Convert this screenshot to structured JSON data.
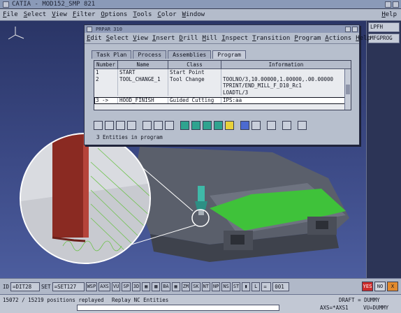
{
  "app": {
    "title": "CATIA - MOD152_SMP 821",
    "menu": [
      "File",
      "Select",
      "View",
      "Filter",
      "Options",
      "Tools",
      "Color",
      "Window"
    ],
    "help": "Help"
  },
  "side_panel": {
    "items": [
      "LPFH",
      "MFGPROG"
    ]
  },
  "dialog": {
    "title": "PRPAR 310",
    "menu": [
      "Edit",
      "Select",
      "View",
      "Insert",
      "Drill",
      "Mill",
      "Inspect",
      "Transition",
      "Program",
      "Actions"
    ],
    "help": "Help",
    "tabs": [
      "Task Plan",
      "Process",
      "Assemblies",
      "Program"
    ],
    "active_tab": "Program",
    "table": {
      "headers": [
        "Number",
        "Name",
        "Class",
        "Information"
      ],
      "rows": [
        {
          "num": "1",
          "name": "START",
          "cls": "Start Point",
          "info": ""
        },
        {
          "num": "2",
          "name": "TOOL_CHANGE_1",
          "cls": "Tool Change",
          "info": "TOOLNO/3,10.00000,1.00000,.00.00000"
        },
        {
          "num": "",
          "name": "",
          "cls": "",
          "info": "TPRINT/END_MILL_F_D10_Rc1"
        },
        {
          "num": "",
          "name": "",
          "cls": "",
          "info": "LOADTL/3"
        },
        {
          "num": "3 ->",
          "name": "HOOD_FINISH",
          "cls": "Guided Cutting",
          "info": "IPS:aa"
        }
      ]
    },
    "toolbar_icons": [
      "copy-icon",
      "paste-icon",
      "edit-icon",
      "flip-icon",
      "insert-left-icon",
      "insert-tool-icon",
      "machine-icon",
      "teal-op-1-icon",
      "teal-op-2-icon",
      "teal-op-3-icon",
      "teal-op-4-icon",
      "fp-icon",
      "blue-box-icon",
      "pencil-icon",
      "arrow-icon",
      "tag-icon",
      "wrench-icon"
    ],
    "status": "3 Entities in program"
  },
  "bottombar": {
    "id_label": "ID",
    "id_value": "=DIT28",
    "set_label": "SET",
    "set_value": "=SET127",
    "buttons": [
      "WSP",
      "AXS",
      "VU",
      "SP",
      "3D"
    ],
    "buttons2": [
      "BA",
      "ZM",
      "SK",
      "NT",
      "NP",
      "NS",
      "ST"
    ],
    "line_label": "L",
    "line_value": "=",
    "count_value": "001",
    "flags": [
      "YES",
      "NO",
      "X"
    ]
  },
  "statusbar": {
    "positions": "15072 / 15219 positions replayed",
    "replay": "Replay NC Entities",
    "draft": "DRAFT = DUMMY",
    "axs": "AXS=*AXS1",
    "vu": "VU=DUMMY",
    "progress": 0.99
  },
  "colors": {
    "accent_green": "#3fc23a",
    "teal": "#2fa38f",
    "model_gray": "#555a66",
    "tool_red": "#8a2a22"
  }
}
